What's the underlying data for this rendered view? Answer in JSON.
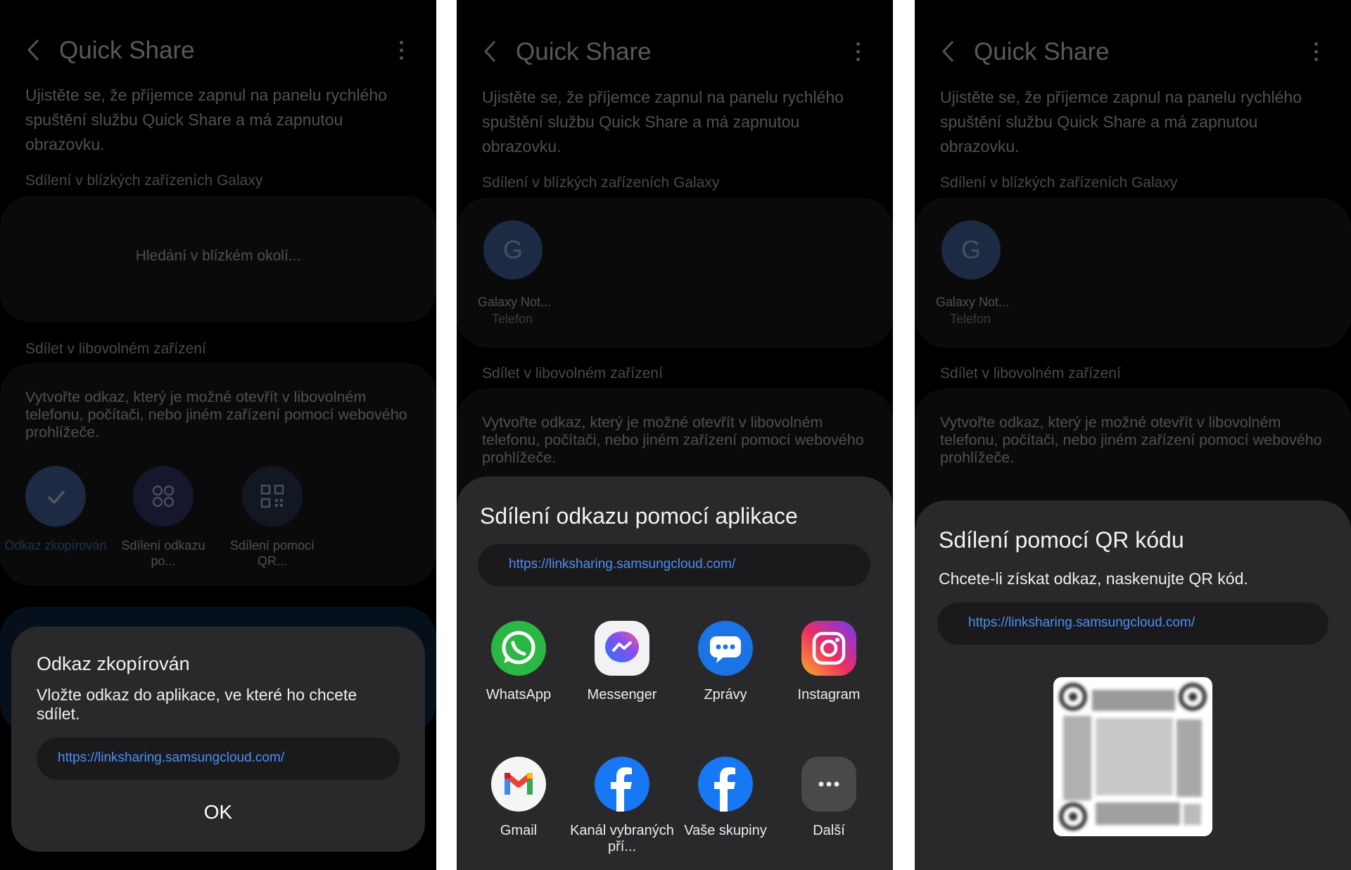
{
  "common": {
    "title": "Quick Share",
    "intro": "Ujistěte se, že příjemce zapnul na panelu rychlého spuštění službu Quick Share a má zapnutou obrazovku.",
    "nearby_section": "Sdílení v blízkých zařízeních Galaxy",
    "any_section": "Sdílet v libovolném zařízení",
    "any_desc": "Vytvořte odkaz, který je možné otevřít v libovolném telefonu, počítači, nebo jiném zařízení pomocí webového prohlížeče.",
    "url": "https://linksharing.samsungcloud.com/"
  },
  "panel1": {
    "searching": "Hledání v blízkém okolí...",
    "buttons": [
      {
        "label": "Odkaz zkopírován",
        "icon": "check-icon"
      },
      {
        "label": "Sdílení odkazu po...",
        "icon": "apps-icon"
      },
      {
        "label": "Sdílení pomocí QR...",
        "icon": "qr-code-icon"
      }
    ],
    "dialog": {
      "title": "Odkaz zkopírován",
      "text": "Vložte odkaz do aplikace, ve které ho chcete sdílet.",
      "ok": "OK"
    }
  },
  "panel2": {
    "device": {
      "initial": "G",
      "name": "Galaxy Not...",
      "type": "Telefon"
    },
    "sheet": {
      "title": "Sdílení odkazu pomocí aplikace",
      "apps": [
        {
          "label": "WhatsApp",
          "icon": "whatsapp-icon"
        },
        {
          "label": "Messenger",
          "icon": "messenger-icon"
        },
        {
          "label": "Zprávy",
          "icon": "messages-icon"
        },
        {
          "label": "Instagram",
          "icon": "instagram-icon"
        },
        {
          "label": "Gmail",
          "icon": "gmail-icon"
        },
        {
          "label": "Kanál vybraných pří...",
          "icon": "facebook-icon"
        },
        {
          "label": "Vaše skupiny",
          "icon": "facebook-icon"
        },
        {
          "label": "Další",
          "icon": "more-icon"
        }
      ]
    }
  },
  "panel3": {
    "device": {
      "initial": "G",
      "name": "Galaxy Not...",
      "type": "Telefon"
    },
    "sheet": {
      "title": "Sdílení pomocí QR kódu",
      "text": "Chcete-li získat odkaz, naskenujte QR kód."
    }
  },
  "colors": {
    "accent": "#4c8ff5",
    "background": "#000000",
    "dialog": "#29292b",
    "card": "#1b1b1d"
  }
}
